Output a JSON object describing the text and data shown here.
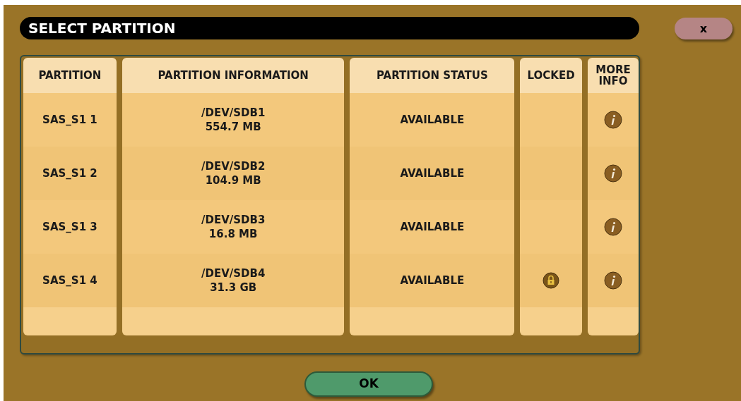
{
  "dialog": {
    "title": "SELECT PARTITION",
    "close_label": "x"
  },
  "table": {
    "columns": [
      "PARTITION",
      "PARTITION INFORMATION",
      "PARTITION STATUS",
      "LOCKED",
      "MORE INFO"
    ],
    "rows": [
      {
        "partition": "SAS_S1 1",
        "device": "/DEV/SDB1",
        "size": "554.7 MB",
        "status": "AVAILABLE",
        "locked": false
      },
      {
        "partition": "SAS_S1 2",
        "device": "/DEV/SDB2",
        "size": "104.9 MB",
        "status": "AVAILABLE",
        "locked": false
      },
      {
        "partition": "SAS_S1 3",
        "device": "/DEV/SDB3",
        "size": "16.8 MB",
        "status": "AVAILABLE",
        "locked": false
      },
      {
        "partition": "SAS_S1 4",
        "device": "/DEV/SDB4",
        "size": "31.3 GB",
        "status": "AVAILABLE",
        "locked": true
      }
    ]
  },
  "buttons": [
    "OK"
  ]
}
